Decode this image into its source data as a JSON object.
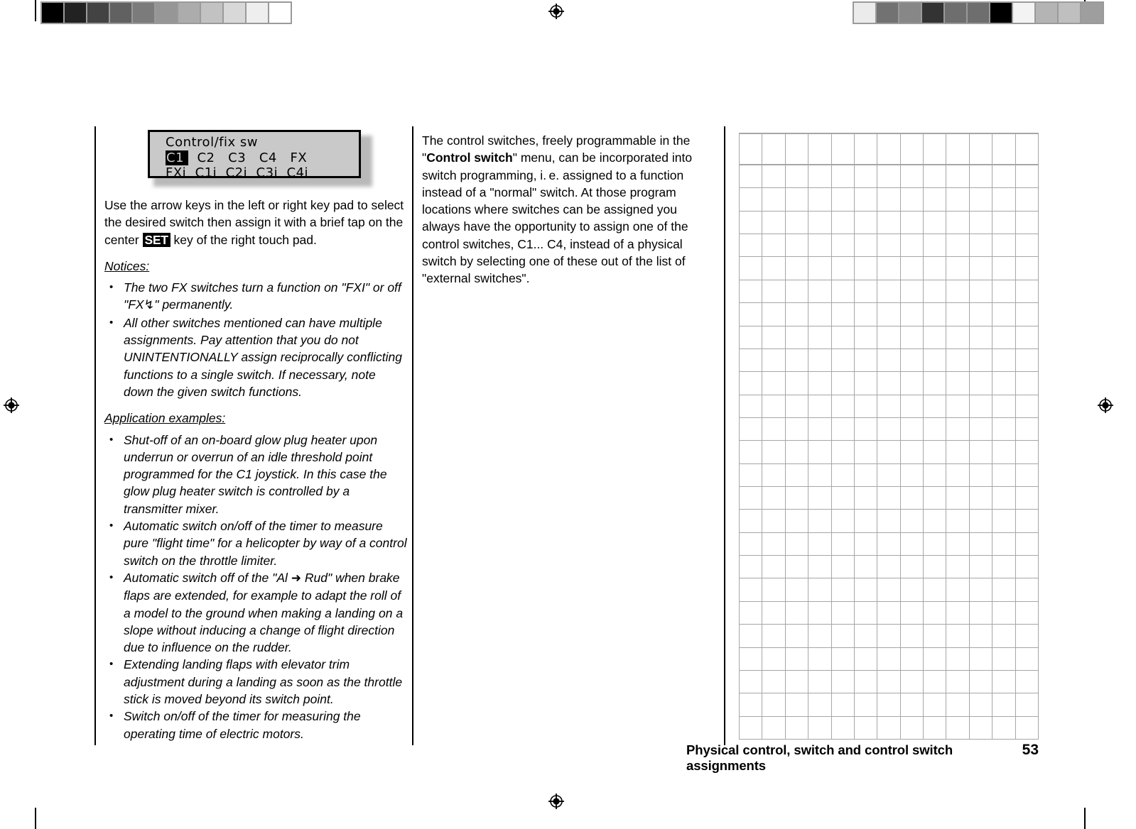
{
  "page": {
    "number": "53",
    "footer_title": "Physical control, switch and control switch assignments"
  },
  "lcd": {
    "title": "Control/fix sw",
    "selected": "C1",
    "row1_rest": "  C2   C3   C4   FX",
    "row2": "FXi  C1i  C2i  C3i  C4i",
    "row1_items": [
      "C1",
      "C2",
      "C3",
      "C4",
      "FX"
    ],
    "row2_items": [
      "FXi",
      "C1i",
      "C2i",
      "C3i",
      "C4i"
    ],
    "bg_color": "#c9c9c9",
    "highlight_color": "#000000"
  },
  "left_column": {
    "intro_part1": "Use the arrow keys in the left or right key pad to select the desired switch then assign it with a brief tap on the center ",
    "set_key_label": "SET",
    "intro_part2": " key of the right touch pad.",
    "notices_heading": "Notices:",
    "notices": [
      {
        "part1": "The two FX switches turn a function on \"FXI\" or off \"FX",
        "glyph": "↯",
        "part2": "\" permanently."
      },
      {
        "part1": "All other switches mentioned can have multiple assignments. Pay attention that you do not UNINTENTIONALLY assign reciprocally conflicting functions to a single switch. If necessary, note down the given switch functions.",
        "glyph": "",
        "part2": ""
      }
    ],
    "examples_heading": "Application examples:",
    "examples": [
      {
        "part1": "Shut-off of an on-board glow plug heater upon underrun or overrun of an idle threshold point programmed for the C1 joystick. In this case the glow plug heater switch is controlled by a transmitter mixer.",
        "glyph": "",
        "part2": ""
      },
      {
        "part1": "Automatic switch on/off of the timer to measure pure \"flight time\" for a helicopter by way of a control switch on the throttle limiter.",
        "glyph": "",
        "part2": ""
      },
      {
        "part1": "Automatic switch off of the \"Al ",
        "glyph": "➜",
        "part2": " Rud\" when brake flaps are extended, for example to adapt the roll of a model to the ground when  making a landing on a slope without inducing a change of flight direction due to influence on the rudder."
      },
      {
        "part1": "Extending landing flaps with elevator trim adjustment during a landing as soon as the throttle stick is moved beyond its switch point.",
        "glyph": "",
        "part2": ""
      },
      {
        "part1": "Switch on/off of the timer for measuring the operating time of electric motors.",
        "glyph": "",
        "part2": ""
      }
    ]
  },
  "middle_column": {
    "para_part1": "The control switches, freely programmable in the \"",
    "bold_term": "Control switch",
    "para_part2": "\" menu, can be incorporated into switch programming, i. e. assigned to a function instead of a \"normal\" switch. At those program locations where switches can be assigned you always have the opportunity to assign one of the control switches, C1... C4, instead of a physical switch by selecting one of these out of the list of \"external switches\"."
  },
  "notes_grid": {
    "columns": 13,
    "rows": 26,
    "line_color": "#a6a6a6"
  },
  "calibration": {
    "left_strip": [
      "#000000",
      "#222222",
      "#434343",
      "#616161",
      "#7b7b7b",
      "#969696",
      "#acacac",
      "#c2c2c2",
      "#d8d8d8",
      "#eeeeee",
      "#ffffff"
    ],
    "right_strip": [
      "#ebebeb",
      "#727272",
      "#878787",
      "#333333",
      "#6e6e6e",
      "#6e6e6e",
      "#000000",
      "#f3f3f3",
      "#b4b4b4",
      "#bfbfbf",
      "#9e9e9e"
    ]
  }
}
